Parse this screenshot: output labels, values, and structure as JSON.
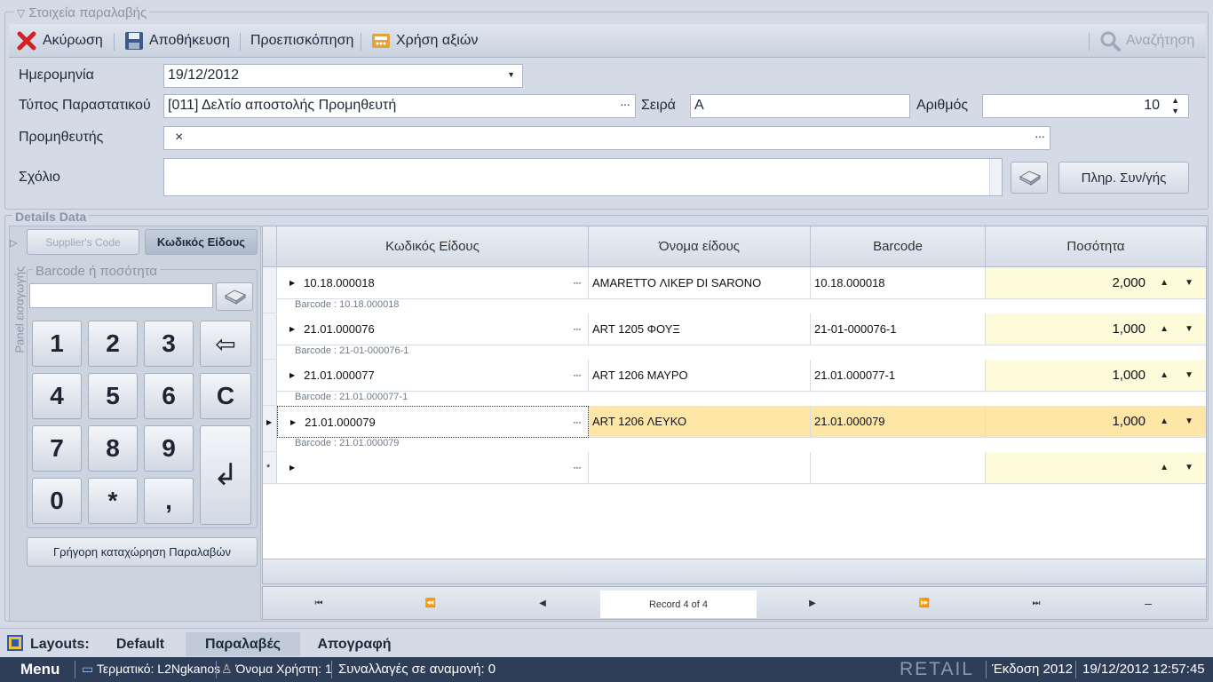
{
  "header": {
    "group_title": "Στοιχεία παραλαβής"
  },
  "toolbar": {
    "cancel": "Ακύρωση",
    "save": "Αποθήκευση",
    "preview": "Προεπισκόπηση",
    "use_values": "Χρήση αξιών",
    "search": "Αναζήτηση"
  },
  "form": {
    "date_label": "Ημερομηνία",
    "date_value": "19/12/2012",
    "doc_type_label": "Τύπος Παραστατικού",
    "doc_type_value": "[011] Δελτίο αποστολής Προμηθευτή",
    "series_label": "Σειρά",
    "series_value": "Α",
    "number_label": "Αριθμός",
    "number_value": "10",
    "supplier_label": "Προμηθευτής",
    "supplier_value": "×",
    "comment_label": "Σχόλιο",
    "comment_value": "",
    "payment_button": "Πληρ. Συν/γής",
    "dots": "···"
  },
  "details": {
    "group_title": "Details Data",
    "panel_label": "Panel εισαγωγής",
    "suppliers_code": "Supplier's Code",
    "item_code": "Κωδικός Είδους",
    "barcode_group": "Barcode ή ποσότητα",
    "barcode_value": "",
    "quick_entry": "Γρήγορη καταχώρηση Παραλαβών"
  },
  "keypad": {
    "k1": "1",
    "k2": "2",
    "k3": "3",
    "kback": "⇦",
    "k4": "4",
    "k5": "5",
    "k6": "6",
    "kc": "C",
    "k7": "7",
    "k8": "8",
    "k9": "9",
    "kenter": "↲",
    "k0": "0",
    "kstar": "*",
    "kcomma": ","
  },
  "grid": {
    "columns": [
      "Κωδικός Είδους",
      "Όνομα είδους",
      "Barcode",
      "Ποσότητα"
    ],
    "rows": [
      {
        "code": "10.18.000018",
        "name": "AMARETTO ΛΙΚΕΡ DI SARONO",
        "barcode": "10.18.000018",
        "qty": "2,000",
        "sub": "Barcode : 10.18.000018"
      },
      {
        "code": "21.01.000076",
        "name": "ART 1205 ΦΟΥΞ",
        "barcode": "21-01-000076-1",
        "qty": "1,000",
        "sub": "Barcode : 21-01-000076-1"
      },
      {
        "code": "21.01.000077",
        "name": "ART 1206 ΜΑΥΡΟ",
        "barcode": "21.01.000077-1",
        "qty": "1,000",
        "sub": "Barcode : 21.01.000077-1"
      },
      {
        "code": "21.01.000079",
        "name": "ART 1206 ΛΕΥΚΟ",
        "barcode": "21.01.000079",
        "qty": "1,000",
        "sub": "Barcode : 21.01.000079"
      }
    ],
    "new_row_marker": "*",
    "record": "Record 4 of 4"
  },
  "layouts": {
    "label": "Layouts:",
    "tabs": [
      "Default",
      "Παραλαβές",
      "Απογραφή"
    ]
  },
  "status": {
    "menu": "Menu",
    "terminal": "Τερματικό: L2Ngkanos",
    "user": "Όνομα Χρήστη: 1",
    "pending": "Συναλλαγές σε αναμονή: 0",
    "brand": "RETAIL",
    "version": "Έκδοση 2012",
    "datetime": "19/12/2012 12:57:45"
  },
  "colors": {
    "accent_row": "#fde6a6",
    "qty_bg": "#fefbdb",
    "status_bg": "#2f3e58"
  }
}
